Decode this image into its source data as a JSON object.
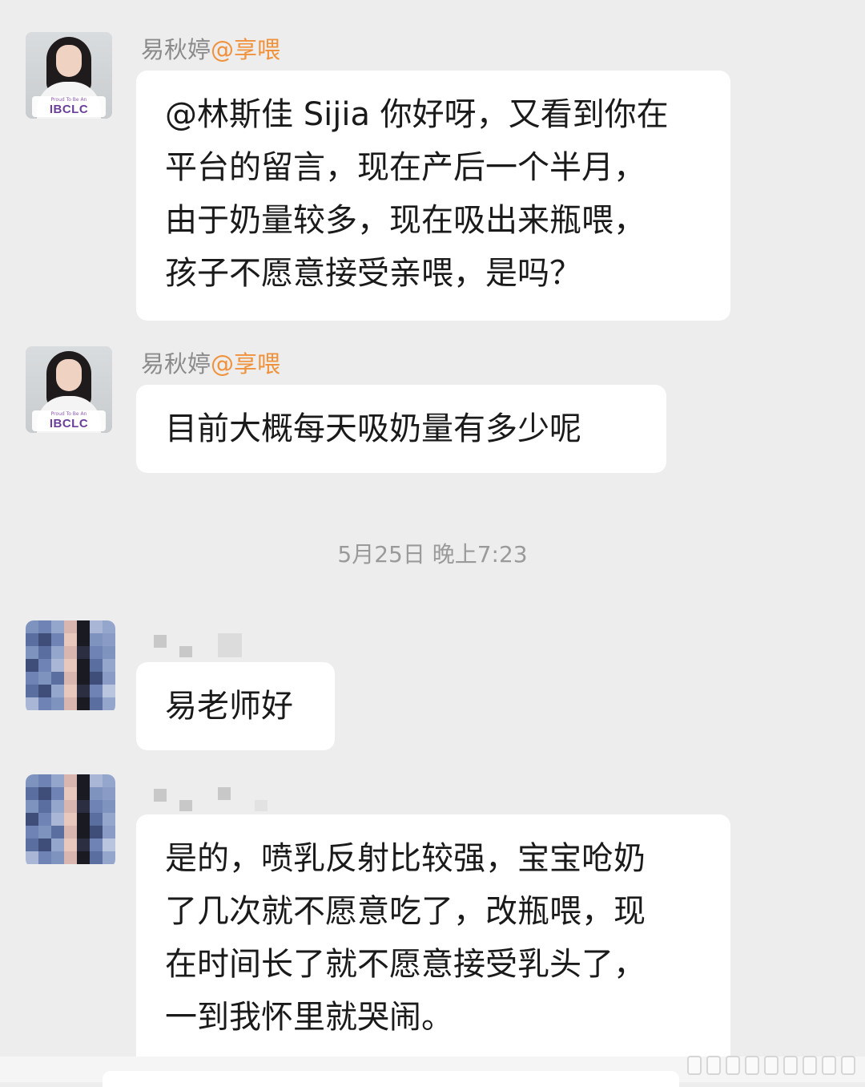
{
  "messages": [
    {
      "sender_name": "易秋婷",
      "sender_tag": "@享喂",
      "avatar_badge_small": "Proud To Be An",
      "avatar_badge_big": "IBCLC",
      "lines": [
        "@林斯佳 Sijia 你好呀，又看到你在",
        "平台的留言，现在产后一个半月，",
        "由于奶量较多，现在吸出来瓶喂，",
        "孩子不愿意接受亲喂，是吗？"
      ]
    },
    {
      "sender_name": "易秋婷",
      "sender_tag": "@享喂",
      "avatar_badge_small": "Proud To Be An",
      "avatar_badge_big": "IBCLC",
      "lines": [
        "目前大概每天吸奶量有多少呢"
      ]
    },
    {
      "lines": [
        "易老师好"
      ]
    },
    {
      "lines": [
        "是的，喷乳反射比较强，宝宝呛奶",
        "了几次就不愿意吃了，改瓶喂，现",
        "在时间长了就不愿意接受乳头了，",
        "一到我怀里就哭闹。"
      ]
    }
  ],
  "timestamp": "5月25日 晚上7:23",
  "colors": {
    "background": "#ededed",
    "bubble": "#ffffff",
    "sender_name": "#8b8b8b",
    "sender_tag": "#f0923c",
    "timestamp": "#9a9a9a"
  }
}
